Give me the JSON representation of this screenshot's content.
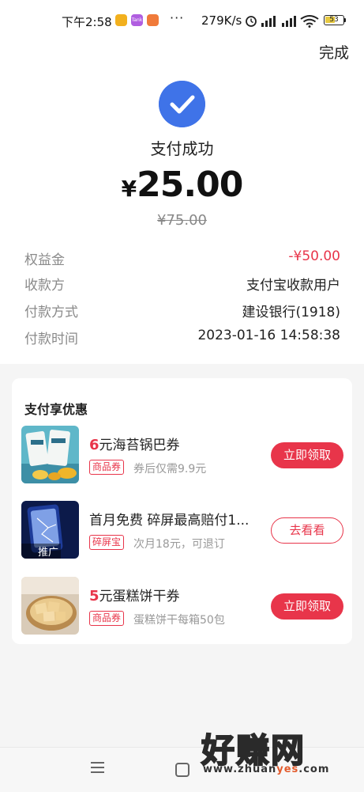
{
  "status_bar": {
    "time": "下午2:58",
    "app_icons": [
      {
        "name": "notes-app-icon",
        "color": "#f2b01e",
        "text": ""
      },
      {
        "name": "task-app-icon",
        "color": "#b05ee0",
        "text": "Tank"
      },
      {
        "name": "cat-app-icon",
        "color": "#f07a3a",
        "text": ""
      }
    ],
    "more": "···",
    "network_speed": "279K/s",
    "battery": "53",
    "battery_color": "#e7c940"
  },
  "header": {
    "done_label": "完成"
  },
  "result": {
    "icon": "check-circle-icon",
    "icon_color": "#3f73e8",
    "title": "支付成功",
    "currency": "¥",
    "amount": "25.00",
    "original_amount": "¥75.00"
  },
  "details": [
    {
      "label": "权益金",
      "value": "-¥50.00",
      "highlight": true
    },
    {
      "label": "收款方",
      "value": "支付宝收款用户",
      "highlight": false
    },
    {
      "label": "付款方式",
      "value": "建设银行(1918)",
      "highlight": false
    },
    {
      "label": "付款时间",
      "value": "2023-01-16 14:58:38",
      "highlight": false
    }
  ],
  "promotions": {
    "title": "支付享优惠",
    "items": [
      {
        "thumb": "seaweed-snack-image",
        "num": "6",
        "title": "元海苔锅巴券",
        "tag": "商品券",
        "subtitle": "券后仅需9.9元",
        "button": "立即领取",
        "button_style": "solid"
      },
      {
        "thumb": "phone-screen-image",
        "thumb_label": "推广",
        "num": "",
        "title": "首月免费  碎屏最高赔付1...",
        "tag": "碎屏宝",
        "subtitle": "次月18元，可退订",
        "button": "去看看",
        "button_style": "outline"
      },
      {
        "thumb": "cake-biscuit-image",
        "num": "5",
        "title": "元蛋糕饼干券",
        "tag": "商品券",
        "subtitle": "蛋糕饼干每箱50包",
        "button": "立即领取",
        "button_style": "solid"
      }
    ]
  },
  "watermark": {
    "text": "好赚网",
    "url_prefix": "www.zhuan",
    "url_accent": "yes",
    "url_suffix": ".com"
  },
  "colors": {
    "accent_red": "#e8354a",
    "brand_blue": "#3f73e8"
  }
}
